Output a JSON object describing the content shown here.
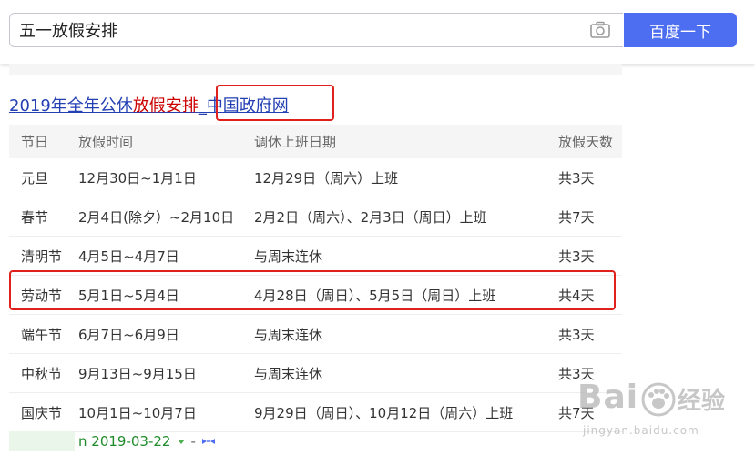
{
  "search": {
    "query": "五一放假安排",
    "button_label": "百度一下"
  },
  "result": {
    "title_part1": "2019年全年公休",
    "title_highlight": "放假安排",
    "title_source": "_中国政府网"
  },
  "table": {
    "headers": [
      "节日",
      "放假时间",
      "调休上班日期",
      "放假天数"
    ],
    "rows": [
      {
        "holiday": "元旦",
        "dates": "12月30日~1月1日",
        "workdays": "12月29日（周六）上班",
        "days": "共3天"
      },
      {
        "holiday": "春节",
        "dates": "2月4日(除夕）~2月10日",
        "workdays": "2月2日（周六）、2月3日（周日）上班",
        "days": "共7天"
      },
      {
        "holiday": "清明节",
        "dates": "4月5日~4月7日",
        "workdays": "与周末连休",
        "days": "共3天"
      },
      {
        "holiday": "劳动节",
        "dates": "5月1日~5月4日",
        "workdays": "4月28日（周日）、5月5日（周日）上班",
        "days": "共4天"
      },
      {
        "holiday": "端午节",
        "dates": "6月7日~6月9日",
        "workdays": "与周末连休",
        "days": "共3天"
      },
      {
        "holiday": "中秋节",
        "dates": "9月13日~9月15日",
        "workdays": "与周末连休",
        "days": "共3天"
      },
      {
        "holiday": "国庆节",
        "dates": "10月1日~10月7日",
        "workdays": "9月29日（周日）、10月12日（周六）上班",
        "days": "共7天"
      }
    ]
  },
  "footer": {
    "date_text": "n 2019-03-22",
    "dash": "-"
  },
  "watermark": {
    "brand": "Bai",
    "product": "经验",
    "url": "jingyan.baidu.com"
  },
  "colors": {
    "accent": "#4e6ef2",
    "link": "#2440b3",
    "highlight": "#c00000",
    "annotation_red": "#e0201d",
    "green": "#1e8a29"
  },
  "icons": {
    "camera": "camera-icon",
    "dropdown": "arrow-down-icon",
    "snapshot": "snapshot-icon",
    "paw": "paw-icon"
  }
}
